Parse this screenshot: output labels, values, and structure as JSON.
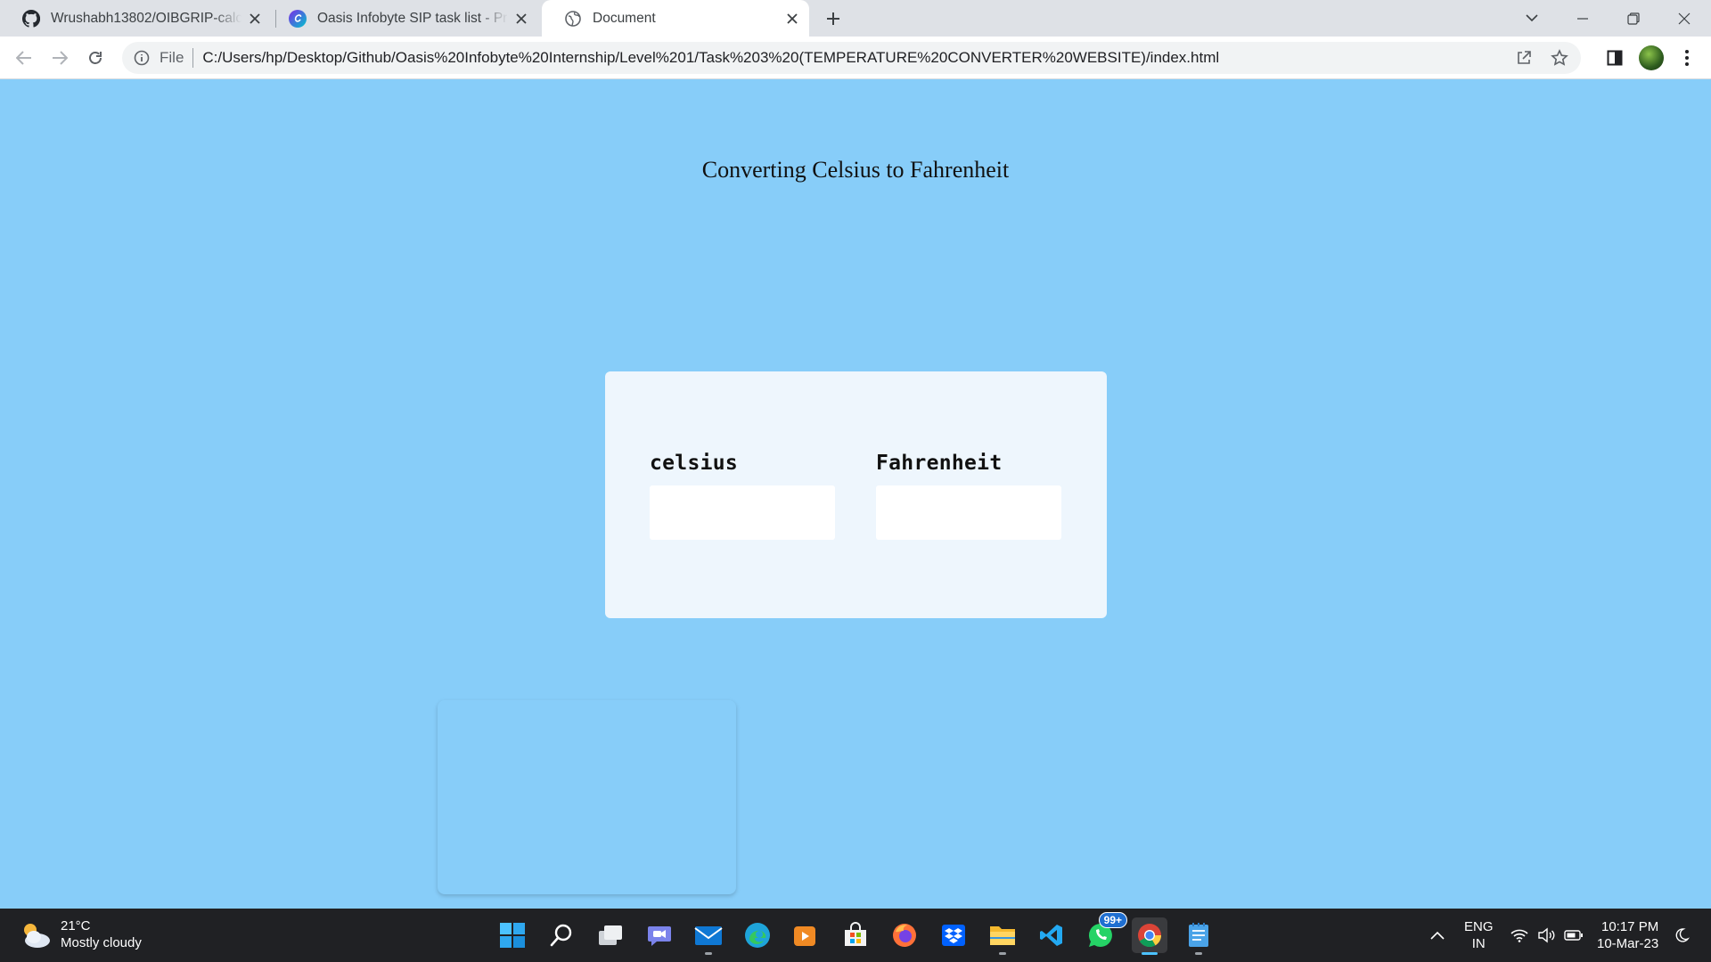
{
  "browser": {
    "tabs": [
      {
        "title": "Wrushabh13802/OIBGRIP-calculator",
        "favicon": "github-icon",
        "active": false
      },
      {
        "title": "Oasis Infobyte SIP task list - Presentation",
        "favicon": "canva-icon",
        "active": false
      },
      {
        "title": "Document",
        "favicon": "globe-icon",
        "active": true
      }
    ],
    "address": {
      "scheme_label": "File",
      "url": "C:/Users/hp/Desktop/Github/Oasis%20Infobyte%20Internship/Level%201/Task%203%20(TEMPERATURE%20CONVERTER%20WEBSITE)/index.html"
    }
  },
  "page": {
    "heading": "Converting Celsius to Fahrenheit",
    "converter": {
      "celsius_label": "celsius",
      "celsius_value": "",
      "fahrenheit_label": "Fahrenheit",
      "fahrenheit_value": ""
    },
    "colors": {
      "background": "#87cdf9",
      "card": "#eef6fd"
    }
  },
  "taskbar": {
    "weather": {
      "temperature": "21°C",
      "condition": "Mostly cloudy"
    },
    "apps": [
      "windows-start-icon",
      "search-icon",
      "task-view-icon",
      "teams-chat-icon",
      "mail-icon",
      "edge-icon",
      "media-player-icon",
      "microsoft-store-icon",
      "firefox-icon",
      "dropbox-icon",
      "file-explorer-icon",
      "vscode-icon",
      "whatsapp-icon",
      "chrome-icon",
      "notepad-icon"
    ],
    "whatsapp_badge": "99+",
    "language": {
      "line1": "ENG",
      "line2": "IN"
    },
    "clock": {
      "time": "10:17 PM",
      "date": "10-Mar-23"
    }
  }
}
